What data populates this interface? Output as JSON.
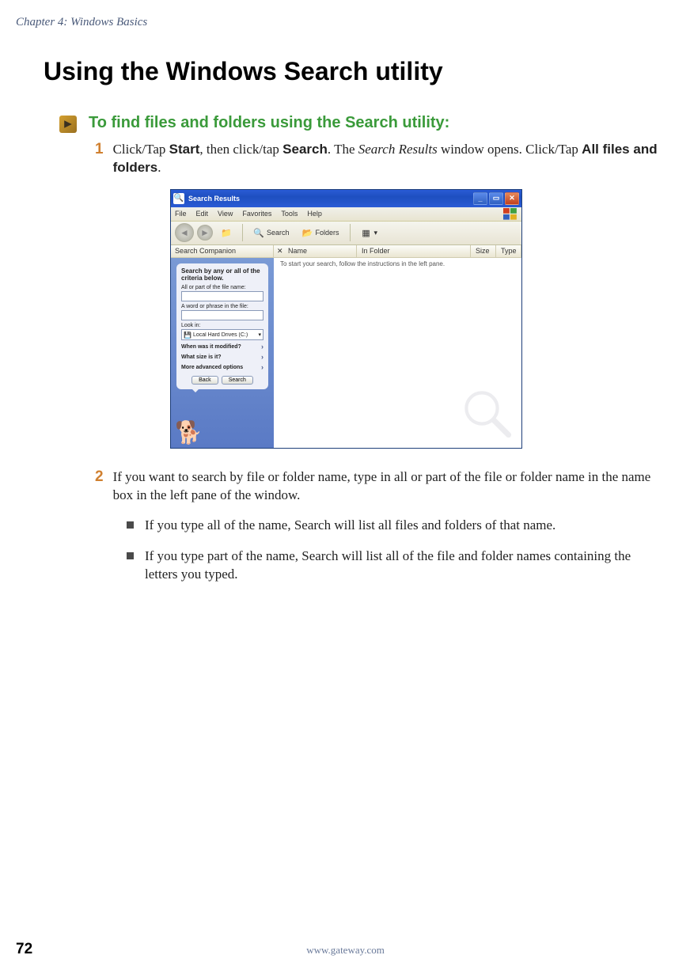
{
  "chapter_header": "Chapter 4: Windows Basics",
  "main_title": "Using the Windows Search utility",
  "procedure_title": "To find files and folders using the Search utility:",
  "step1": {
    "num": "1",
    "t1": "Click/Tap ",
    "b1": "Start",
    "t2": ", then click/tap ",
    "b2": "Search",
    "t3": ". The ",
    "i1": "Search Results",
    "t4": " window opens. Click/Tap ",
    "b3": "All files and folders",
    "t5": "."
  },
  "screenshot": {
    "title": "Search Results",
    "menu": {
      "file": "File",
      "edit": "Edit",
      "view": "View",
      "favorites": "Favorites",
      "tools": "Tools",
      "help": "Help"
    },
    "toolbar": {
      "search": "Search",
      "folders": "Folders"
    },
    "cols": {
      "companion": "Search Companion",
      "name": "Name",
      "folder": "In Folder",
      "size": "Size",
      "type": "Type"
    },
    "balloon": {
      "title": "Search by any or all of the criteria below.",
      "label1": "All or part of the file name:",
      "label2": "A word or phrase in the file:",
      "label3": "Look in:",
      "select_val": "Local Hard Drives (C:)",
      "row1": "When was it modified?",
      "row2": "What size is it?",
      "row3": "More advanced options",
      "btn_back": "Back",
      "btn_search": "Search"
    },
    "hint": "To start your search, follow the instructions in the left pane."
  },
  "step2": {
    "num": "2",
    "text": "If you want to search by file or folder name, type in all or part of the file or folder name in the name box in the left pane of the window."
  },
  "bullets": {
    "b1": "If you type all of the name, Search will list all files and folders of that name.",
    "b2": "If you type part of the name, Search will list all of the file and folder names containing the letters you typed."
  },
  "footer": {
    "page": "72",
    "url": "www.gateway.com"
  }
}
